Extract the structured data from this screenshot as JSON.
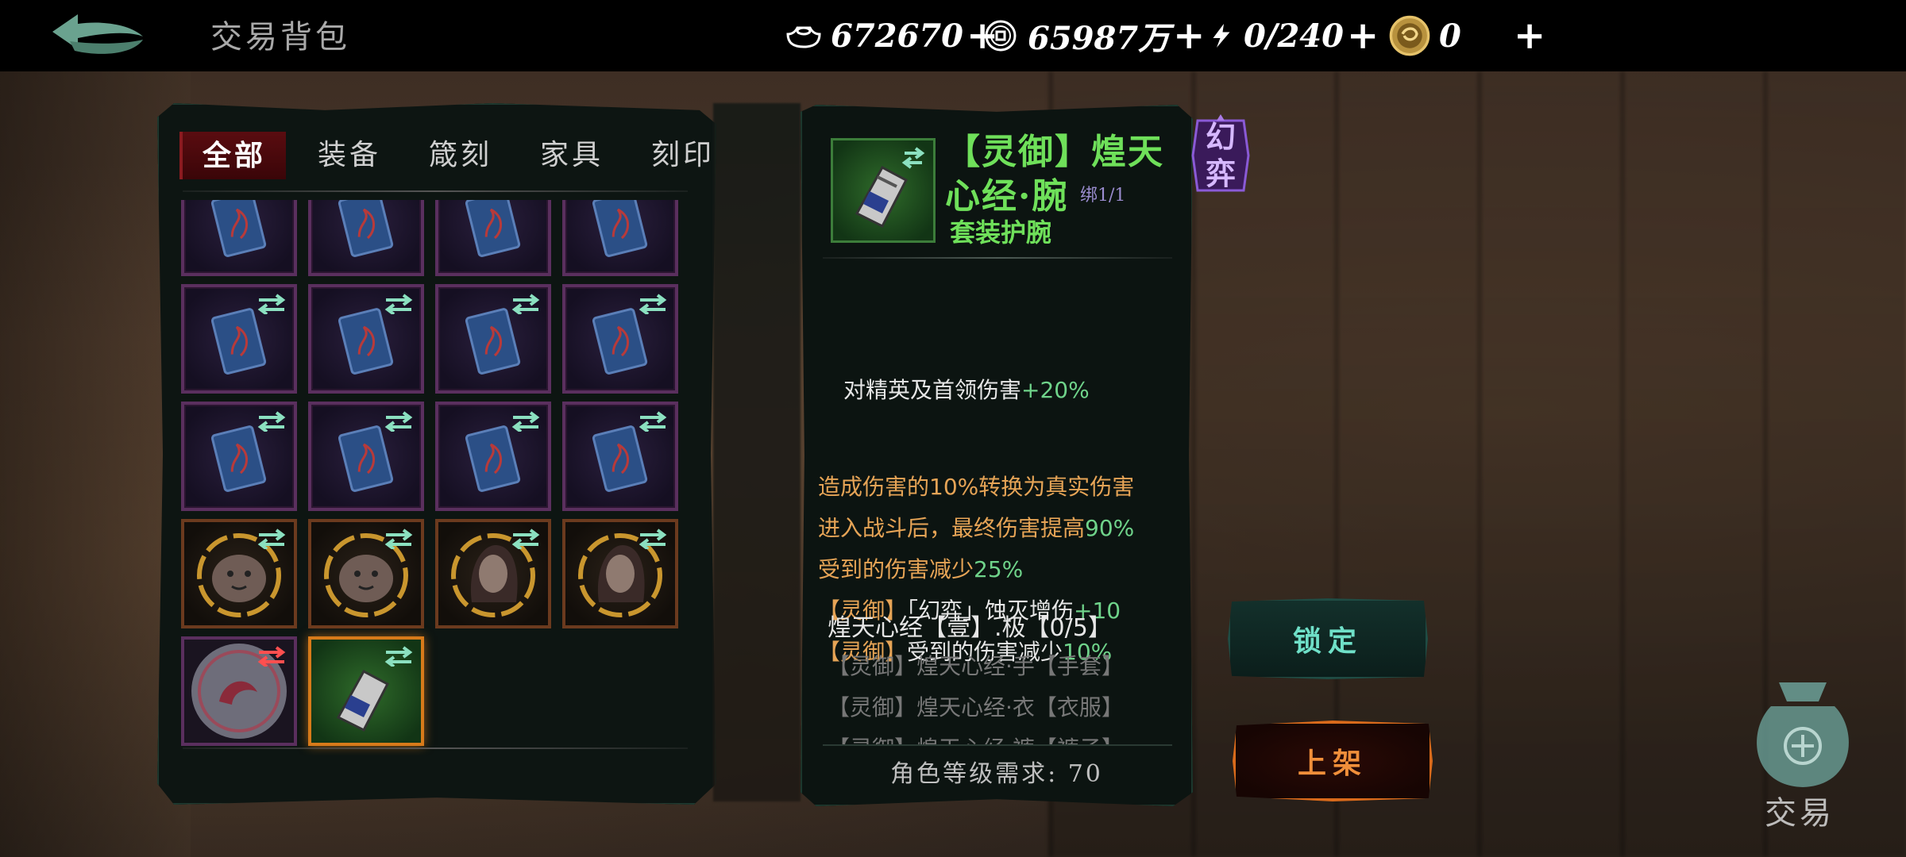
{
  "header": {
    "title": "交易背包",
    "resources": [
      {
        "icon": "silver-ingot-icon",
        "value": "672670"
      },
      {
        "icon": "copper-coin-icon",
        "value": "65987万"
      },
      {
        "icon": "lightning-icon",
        "value": "0/240"
      },
      {
        "icon": "gold-token-icon",
        "value": "0"
      }
    ]
  },
  "inventory": {
    "tabs": [
      {
        "label": "全部",
        "active": true
      },
      {
        "label": "装备",
        "active": false
      },
      {
        "label": "箴刻",
        "active": false
      },
      {
        "label": "家具",
        "active": false
      },
      {
        "label": "刻印",
        "active": false
      }
    ],
    "slots": [
      {
        "type": "purple",
        "item": "blue-card-icon"
      },
      {
        "type": "purple",
        "item": "blue-card-icon"
      },
      {
        "type": "purple",
        "item": "blue-card-icon"
      },
      {
        "type": "purple",
        "item": "blue-card-icon"
      },
      {
        "type": "purple",
        "item": "blue-card-icon"
      },
      {
        "type": "purple",
        "item": "blue-card-icon"
      },
      {
        "type": "purple",
        "item": "blue-card-icon"
      },
      {
        "type": "purple",
        "item": "blue-card-icon"
      },
      {
        "type": "purple",
        "item": "blue-card-icon"
      },
      {
        "type": "purple",
        "item": "blue-card-icon"
      },
      {
        "type": "purple",
        "item": "blue-card-icon"
      },
      {
        "type": "purple",
        "item": "blue-card-icon"
      },
      {
        "type": "gold",
        "item": "creature-portrait-icon"
      },
      {
        "type": "gold",
        "item": "creature-portrait-icon"
      },
      {
        "type": "gold",
        "item": "woman-portrait-icon"
      },
      {
        "type": "gold",
        "item": "woman-portrait-icon"
      },
      {
        "type": "redorb",
        "item": "red-orb-icon"
      },
      {
        "type": "green",
        "item": "bracer-icon"
      }
    ]
  },
  "detail": {
    "name": "【灵御】煌天心经·腕",
    "bind": "绑1/1",
    "type": "套装护腕",
    "badge": "幻弈",
    "stats": [
      {
        "parts": [
          {
            "t": "对精英及首领伤害",
            "c": "white"
          },
          {
            "t": "+20%",
            "c": "green"
          }
        ]
      },
      {
        "parts": [
          {
            "t": "造成伤害的10%转换为真实伤害",
            "c": "orange"
          }
        ]
      },
      {
        "parts": [
          {
            "t": "进入战斗后，最终伤害提高",
            "c": "orange"
          },
          {
            "t": "90%",
            "c": "green"
          }
        ]
      },
      {
        "parts": [
          {
            "t": "受到的伤害减少",
            "c": "orange"
          },
          {
            "t": "25%",
            "c": "green"
          }
        ]
      },
      {
        "parts": [
          {
            "t": "【灵御】",
            "c": "orange"
          },
          {
            "t": "「幻弈」蚀灭增伤",
            "c": "white"
          },
          {
            "t": "+10",
            "c": "green"
          }
        ]
      },
      {
        "parts": [
          {
            "t": "【灵御】",
            "c": "orange"
          },
          {
            "t": "受到的伤害减少",
            "c": "white"
          },
          {
            "t": "10%",
            "c": "green"
          }
        ]
      }
    ],
    "set_title": "煌天心经【壹】.极【0/5】",
    "set_items": [
      "【灵御】煌天心经·手【手套】",
      "【灵御】煌天心经·衣【衣服】",
      "【灵御】煌天心经·裤【裤子】"
    ],
    "requirement": "角色等级需求: 70"
  },
  "actions": {
    "lock": "锁定",
    "sell": "上架",
    "trade": "交易"
  },
  "colors": {
    "accent_green": "#6fe05a",
    "stat_orange": "#e6a456",
    "sell_orange": "#d96a1b"
  }
}
